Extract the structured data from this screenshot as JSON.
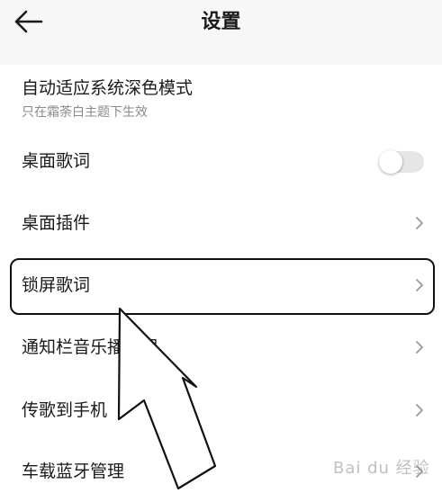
{
  "header": {
    "title": "设置",
    "back_icon": "arrow-left-icon"
  },
  "settings": {
    "dark_mode": {
      "label": "自动适应系统深色模式",
      "description": "只在霜荼白主题下生效"
    },
    "desktop_lyrics": {
      "label": "桌面歌词",
      "toggle_on": false
    },
    "desktop_widget": {
      "label": "桌面插件"
    },
    "lockscreen_lyrics": {
      "label": "锁屏歌词"
    },
    "notification_player": {
      "label": "通知栏音乐播放器"
    },
    "send_to_phone": {
      "label": "传歌到手机"
    },
    "car_bluetooth": {
      "label": "车载蓝牙管理"
    }
  },
  "annotation": {
    "highlight_target": "锁屏歌词",
    "pointer": "arrow-icon"
  },
  "watermark": {
    "text": "Bai du 经验"
  }
}
